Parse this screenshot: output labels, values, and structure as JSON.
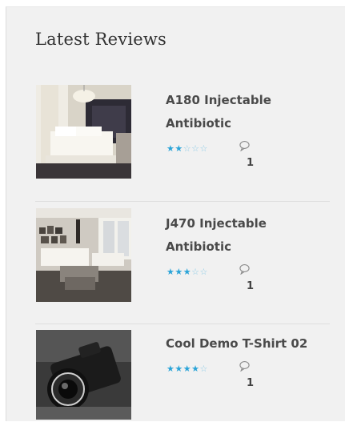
{
  "widget": {
    "title": "Latest Reviews"
  },
  "reviews": [
    {
      "title_line1": "A180 Injectable",
      "title_line2": "Antibiotic",
      "rating": 2,
      "max_rating": 5,
      "comment_count": "1",
      "thumbnail": "bedroom-photo"
    },
    {
      "title_line1": "J470 Injectable",
      "title_line2": "Antibiotic",
      "rating": 3,
      "max_rating": 5,
      "comment_count": "1",
      "thumbnail": "living-room-photo"
    },
    {
      "title_line1": "Cool Demo T-Shirt 02",
      "title_line2": "",
      "rating": 4,
      "max_rating": 5,
      "comment_count": "1",
      "thumbnail": "camera-photo"
    }
  ],
  "colors": {
    "star": "#2aa4d8",
    "title": "#4a4a4a",
    "background": "#f1f1f1"
  },
  "icons": {
    "comment": "speech-bubble-icon",
    "star": "star-icon"
  }
}
